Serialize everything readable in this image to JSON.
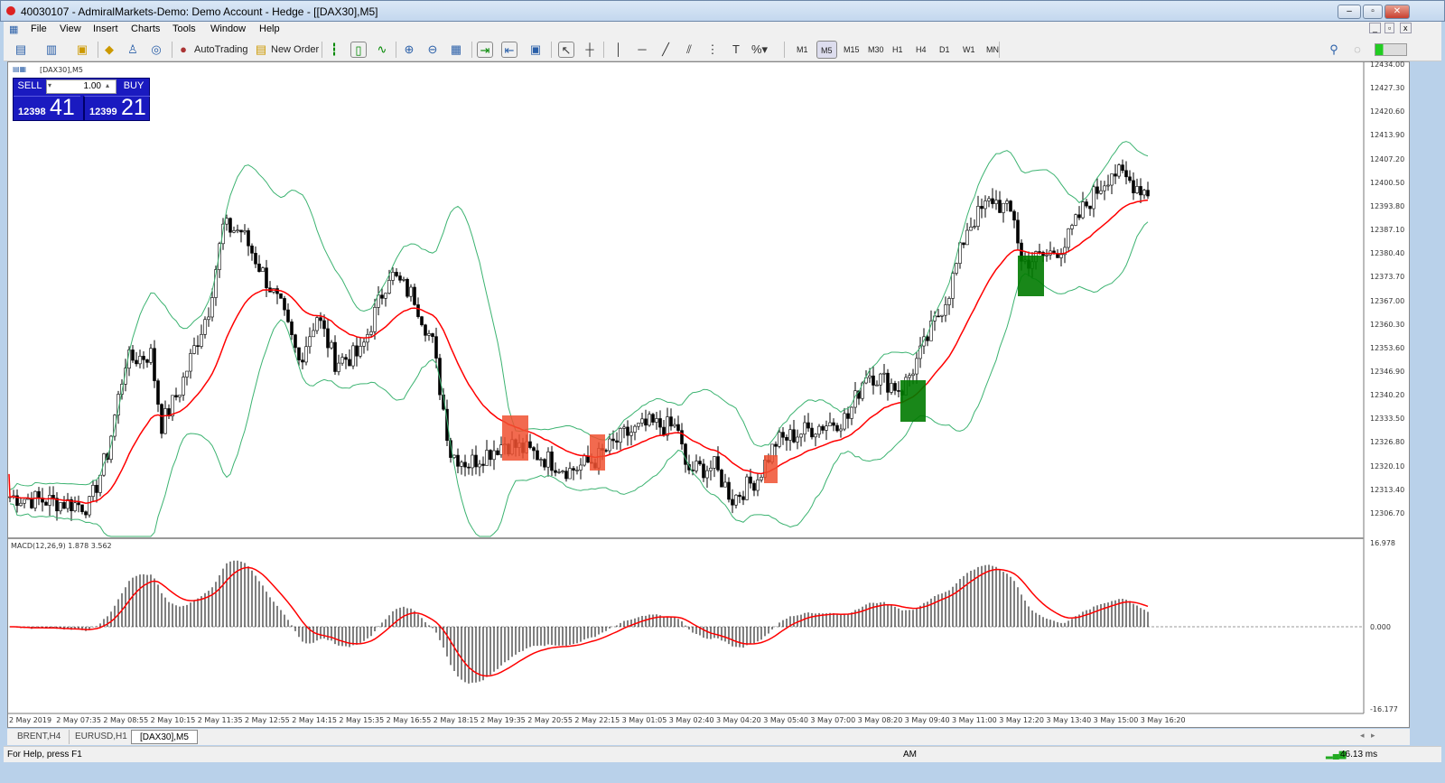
{
  "window": {
    "title": "40030107 - AdmiralMarkets-Demo: Demo Account - Hedge - [[DAX30],M5]"
  },
  "menu": [
    "File",
    "View",
    "Insert",
    "Charts",
    "Tools",
    "Window",
    "Help"
  ],
  "toolbar": {
    "autotrading": "AutoTrading",
    "new_order": "New Order",
    "timeframes": [
      "M1",
      "M5",
      "M15",
      "M30",
      "H1",
      "H4",
      "D1",
      "W1",
      "MN"
    ],
    "active_timeframe": "M5"
  },
  "chart": {
    "symbol_label": "[DAX30],M5",
    "trade_panel": {
      "sell": "SELL",
      "buy": "BUY",
      "lot": "1.00",
      "sell_prefix": "12398",
      "sell_big": "41",
      "buy_prefix": "12399",
      "buy_big": "21"
    },
    "price_axis": [
      "12434.00",
      "12427.30",
      "12420.60",
      "12413.90",
      "12407.20",
      "12400.50",
      "12393.80",
      "12387.10",
      "12380.40",
      "12373.70",
      "12367.00",
      "12360.30",
      "12353.60",
      "12346.90",
      "12340.20",
      "12333.50",
      "12326.80",
      "12320.10",
      "12313.40",
      "12306.70"
    ],
    "macd_label": "MACD(12,26,9) 1.878 3.562",
    "macd_axis": {
      "top": "16.978",
      "zero": "0.000",
      "bottom": "-16.177"
    },
    "time_axis": [
      "2 May 2019",
      "2 May 07:35",
      "2 May 08:55",
      "2 May 10:15",
      "2 May 11:35",
      "2 May 12:55",
      "2 May 14:15",
      "2 May 15:35",
      "2 May 16:55",
      "2 May 18:15",
      "2 May 19:35",
      "2 May 20:55",
      "2 May 22:15",
      "3 May 01:05",
      "3 May 02:40",
      "3 May 04:20",
      "3 May 05:40",
      "3 May 07:00",
      "3 May 08:20",
      "3 May 09:40",
      "3 May 11:00",
      "3 May 12:20",
      "3 May 13:40",
      "3 May 15:00",
      "3 May 16:20"
    ],
    "price_path": [
      [
        0,
        12311.6
      ],
      [
        22,
        12309
      ],
      [
        27,
        12324
      ],
      [
        32,
        12350
      ],
      [
        39,
        12352
      ],
      [
        42,
        12332
      ],
      [
        47,
        12342
      ],
      [
        55,
        12365
      ],
      [
        59,
        12388
      ],
      [
        64,
        12387
      ],
      [
        70,
        12375
      ],
      [
        75,
        12365
      ],
      [
        80,
        12350
      ],
      [
        85,
        12363
      ],
      [
        90,
        12350
      ],
      [
        97,
        12352
      ],
      [
        105,
        12375
      ],
      [
        112,
        12368
      ],
      [
        117,
        12355
      ],
      [
        122,
        12324
      ],
      [
        127,
        12321
      ],
      [
        137,
        12327
      ],
      [
        147,
        12323
      ],
      [
        155,
        12319
      ],
      [
        162,
        12322
      ],
      [
        170,
        12329
      ],
      [
        177,
        12332
      ],
      [
        185,
        12331
      ],
      [
        187,
        12319
      ],
      [
        195,
        12320
      ],
      [
        200,
        12311
      ],
      [
        207,
        12317
      ],
      [
        212,
        12327
      ],
      [
        222,
        12331
      ],
      [
        232,
        12334
      ],
      [
        237,
        12347
      ],
      [
        247,
        12342
      ],
      [
        252,
        12352
      ],
      [
        260,
        12370
      ],
      [
        265,
        12388
      ],
      [
        272,
        12396
      ],
      [
        278,
        12391
      ],
      [
        280,
        12378
      ],
      [
        287,
        12380
      ],
      [
        292,
        12383
      ],
      [
        297,
        12393
      ],
      [
        305,
        12404
      ],
      [
        310,
        12401
      ],
      [
        315,
        12398
      ]
    ],
    "colors": {
      "ma": "#ff0000",
      "bands": "#3cb371",
      "sell_box": "#f05030",
      "buy_box": "#007a00"
    }
  },
  "tabs": [
    "BRENT,H4",
    "EURUSD,H1",
    "[DAX30],M5"
  ],
  "status": {
    "help": "For Help, press F1",
    "profile": "AM",
    "ping": "46.13 ms"
  }
}
